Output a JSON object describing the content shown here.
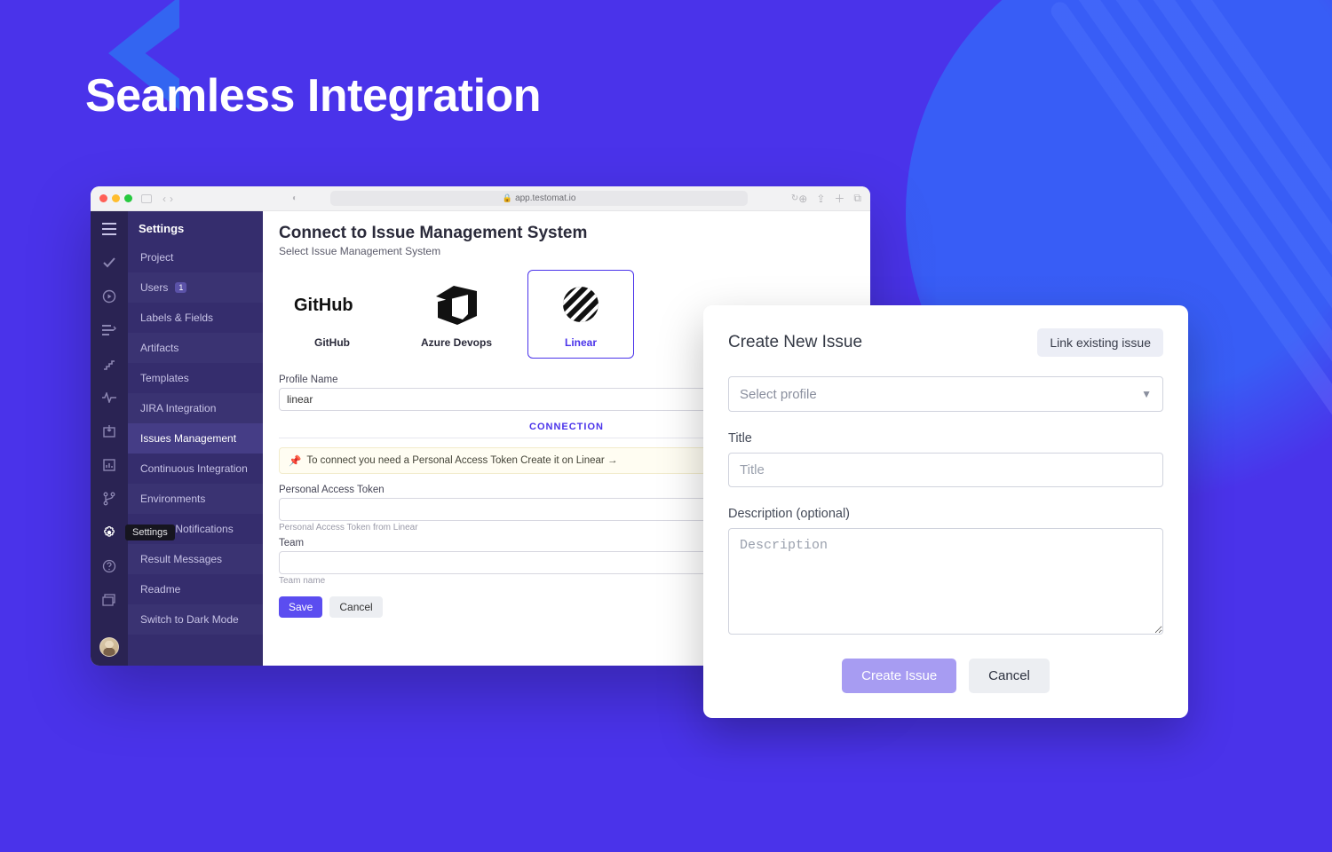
{
  "page": {
    "title": "Seamless Integration"
  },
  "browser": {
    "address": "app.testomat.io"
  },
  "rail_tooltip": "Settings",
  "sidebar": {
    "title": "Settings",
    "items": [
      {
        "label": "Project"
      },
      {
        "label": "Users",
        "badge": "1"
      },
      {
        "label": "Labels & Fields"
      },
      {
        "label": "Artifacts"
      },
      {
        "label": "Templates"
      },
      {
        "label": "JIRA Integration"
      },
      {
        "label": "Issues Management",
        "active": true
      },
      {
        "label": "Continuous Integration"
      },
      {
        "label": "Environments"
      },
      {
        "label": "Report Notifications"
      },
      {
        "label": "Result Messages"
      },
      {
        "label": "Readme"
      },
      {
        "label": "Switch to Dark Mode"
      }
    ]
  },
  "main": {
    "heading": "Connect to Issue Management System",
    "subheading": "Select Issue Management System",
    "systems": [
      {
        "name": "GitHub"
      },
      {
        "name": "Azure Devops"
      },
      {
        "name": "Linear",
        "selected": true
      }
    ],
    "profile_name_label": "Profile Name",
    "profile_name_value": "linear",
    "connection_header": "CONNECTION",
    "notice": "To connect you need a Personal Access Token Create it on Linear →",
    "pat_label": "Personal Access Token",
    "pat_hint": "Personal Access Token from Linear",
    "team_label": "Team",
    "team_hint": "Team name",
    "save": "Save",
    "cancel": "Cancel"
  },
  "issue_panel": {
    "title": "Create New Issue",
    "link_button": "Link existing issue",
    "select_placeholder": "Select profile",
    "title_label": "Title",
    "title_placeholder": "Title",
    "description_label": "Description (optional)",
    "description_placeholder": "Description",
    "create": "Create Issue",
    "cancel": "Cancel"
  }
}
